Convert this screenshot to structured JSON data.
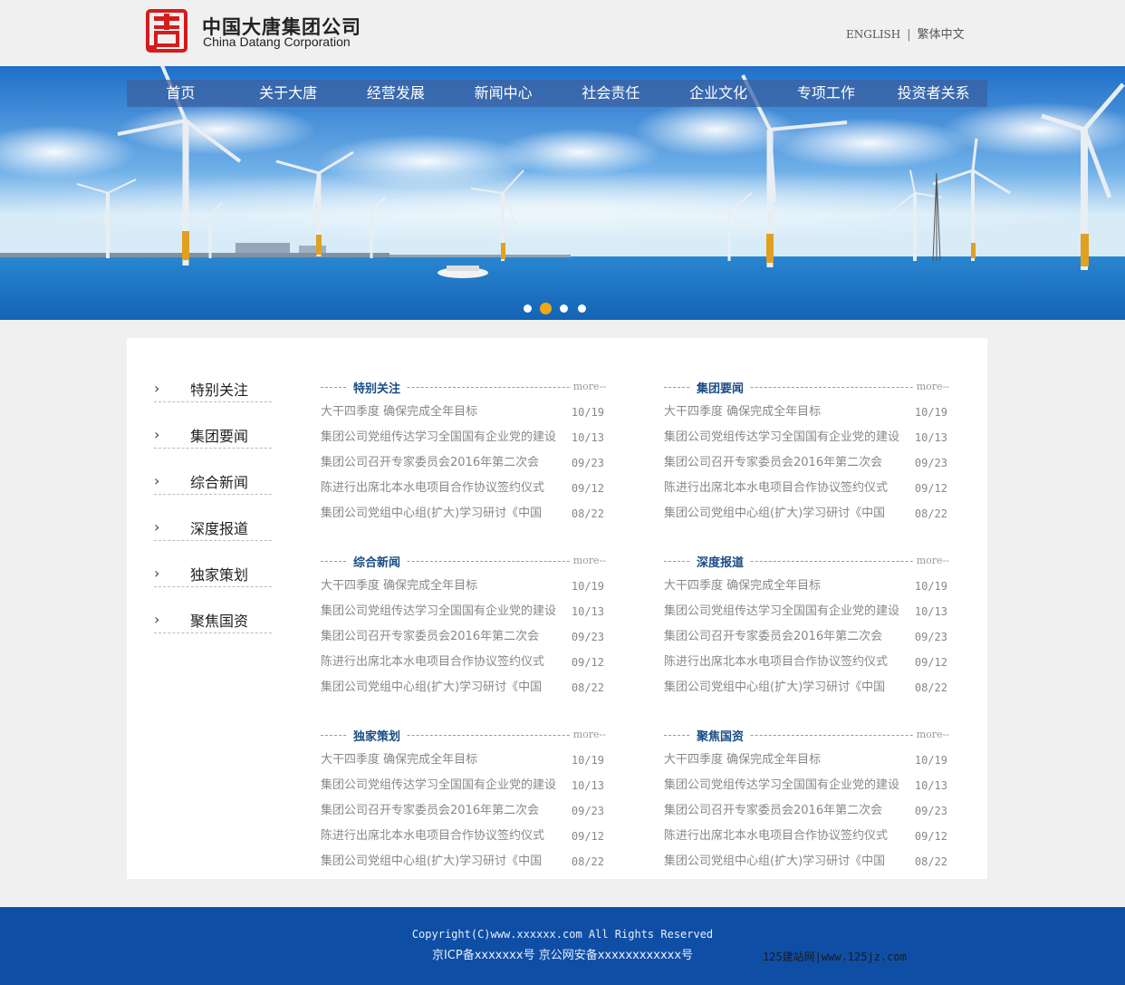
{
  "brand": {
    "logo_cn": "中国大唐集团公司",
    "logo_en": "China Datang Corporation",
    "logo_color": "#d51c1c"
  },
  "lang": {
    "english": "ENGLISH",
    "separator": "|",
    "traditional": "繁体中文"
  },
  "nav": [
    "首页",
    "关于大唐",
    "经营发展",
    "新闻中心",
    "社会责任",
    "企业文化",
    "专项工作",
    "投资者关系"
  ],
  "banner": {
    "slide_count": 4,
    "active_slide": 2,
    "active_color": "#f1a713"
  },
  "sidebar": [
    "特别关注",
    "集团要闻",
    "综合新闻",
    "深度报道",
    "独家策划",
    "聚焦国资"
  ],
  "sections": [
    {
      "title": "特别关注",
      "more": "more",
      "items": [
        {
          "title": "大干四季度 确保完成全年目标",
          "date": "10/19"
        },
        {
          "title": "集团公司党组传达学习全国国有企业党的建设",
          "date": "10/13"
        },
        {
          "title": "集团公司召开专家委员会2016年第二次会",
          "date": "09/23"
        },
        {
          "title": "陈进行出席北本水电项目合作协议签约仪式",
          "date": "09/12"
        },
        {
          "title": "集团公司党组中心组(扩大)学习研讨《中国",
          "date": "08/22"
        }
      ]
    },
    {
      "title": "集团要闻",
      "more": "more",
      "items": [
        {
          "title": "大干四季度 确保完成全年目标",
          "date": "10/19"
        },
        {
          "title": "集团公司党组传达学习全国国有企业党的建设",
          "date": "10/13"
        },
        {
          "title": "集团公司召开专家委员会2016年第二次会",
          "date": "09/23"
        },
        {
          "title": "陈进行出席北本水电项目合作协议签约仪式",
          "date": "09/12"
        },
        {
          "title": "集团公司党组中心组(扩大)学习研讨《中国",
          "date": "08/22"
        }
      ]
    },
    {
      "title": "综合新闻",
      "more": "more",
      "items": [
        {
          "title": "大干四季度 确保完成全年目标",
          "date": "10/19"
        },
        {
          "title": "集团公司党组传达学习全国国有企业党的建设",
          "date": "10/13"
        },
        {
          "title": "集团公司召开专家委员会2016年第二次会",
          "date": "09/23"
        },
        {
          "title": "陈进行出席北本水电项目合作协议签约仪式",
          "date": "09/12"
        },
        {
          "title": "集团公司党组中心组(扩大)学习研讨《中国",
          "date": "08/22"
        }
      ]
    },
    {
      "title": "深度报道",
      "more": "more",
      "items": [
        {
          "title": "大干四季度 确保完成全年目标",
          "date": "10/19"
        },
        {
          "title": "集团公司党组传达学习全国国有企业党的建设",
          "date": "10/13"
        },
        {
          "title": "集团公司召开专家委员会2016年第二次会",
          "date": "09/23"
        },
        {
          "title": "陈进行出席北本水电项目合作协议签约仪式",
          "date": "09/12"
        },
        {
          "title": "集团公司党组中心组(扩大)学习研讨《中国",
          "date": "08/22"
        }
      ]
    },
    {
      "title": "独家策划",
      "more": "more",
      "items": [
        {
          "title": "大干四季度 确保完成全年目标",
          "date": "10/19"
        },
        {
          "title": "集团公司党组传达学习全国国有企业党的建设",
          "date": "10/13"
        },
        {
          "title": "集团公司召开专家委员会2016年第二次会",
          "date": "09/23"
        },
        {
          "title": "陈进行出席北本水电项目合作协议签约仪式",
          "date": "09/12"
        },
        {
          "title": "集团公司党组中心组(扩大)学习研讨《中国",
          "date": "08/22"
        }
      ]
    },
    {
      "title": "聚焦国资",
      "more": "more",
      "items": [
        {
          "title": "大干四季度 确保完成全年目标",
          "date": "10/19"
        },
        {
          "title": "集团公司党组传达学习全国国有企业党的建设",
          "date": "10/13"
        },
        {
          "title": "集团公司召开专家委员会2016年第二次会",
          "date": "09/23"
        },
        {
          "title": "陈进行出席北本水电项目合作协议签约仪式",
          "date": "09/12"
        },
        {
          "title": "集团公司党组中心组(扩大)学习研讨《中国",
          "date": "08/22"
        }
      ]
    }
  ],
  "footer": {
    "copyright": "Copyright(C)www.xxxxxx.com All Rights Reserved",
    "icp": "京ICP备xxxxxxx号 京公网安备xxxxxxxxxxxx号",
    "watermark": "125建站网|www.125jz.com",
    "bg_color": "#0f4ea5"
  }
}
